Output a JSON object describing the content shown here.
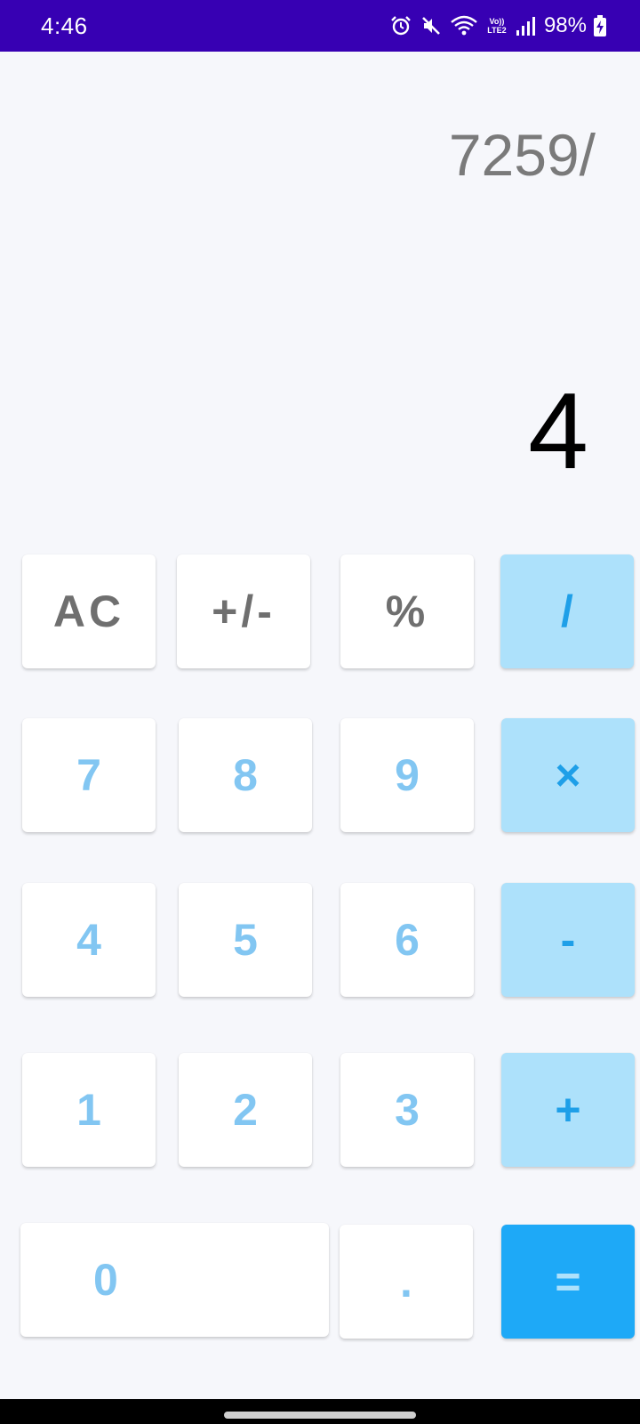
{
  "status_bar": {
    "time": "4:46",
    "network_label": "Vo)) LTE2",
    "battery": "98%",
    "icons": [
      "alarm-icon",
      "mute-icon",
      "wifi-icon",
      "volte-icon",
      "signal-icon",
      "battery-charging-icon"
    ]
  },
  "display": {
    "expression": "7259/",
    "result": "4"
  },
  "keypad": {
    "ac": "AC",
    "plus_minus": "+/-",
    "percent": "%",
    "divide": "/",
    "seven": "7",
    "eight": "8",
    "nine": "9",
    "multiply": "×",
    "four": "4",
    "five": "5",
    "six": "6",
    "minus": "-",
    "one": "1",
    "two": "2",
    "three": "3",
    "plus": "+",
    "zero": "0",
    "dot": ".",
    "equals": "="
  },
  "colors": {
    "status_bar": "#3700b3",
    "background": "#f6f7fb",
    "digit_text": "#82c6f2",
    "operator_bg": "#ade1fb",
    "operator_text": "#1e9fe8",
    "equals_bg": "#1ea9f7"
  }
}
